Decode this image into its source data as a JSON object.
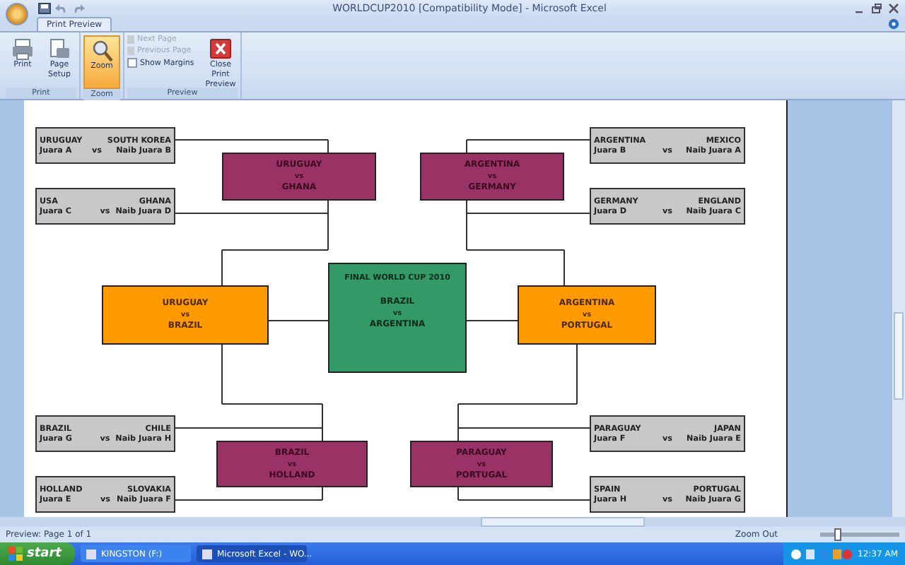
{
  "window": {
    "title": "WORLDCUP2010  [Compatibility Mode] - Microsoft Excel"
  },
  "tabs": [
    {
      "label": "Print Preview",
      "selected": true
    }
  ],
  "ribbon": {
    "groups": [
      {
        "label": "Print",
        "buttons": [
          {
            "kind": "printer",
            "label": "Print",
            "selected": false
          },
          {
            "kind": "setup",
            "label": "Page Setup",
            "selected": false
          }
        ]
      },
      {
        "label": "Zoom",
        "buttons": [
          {
            "kind": "zoom",
            "label": "Zoom",
            "selected": true
          }
        ]
      },
      {
        "label": "Preview",
        "items": [
          {
            "kind": "command",
            "label": "Next Page",
            "disabled": true
          },
          {
            "kind": "command",
            "label": "Previous Page",
            "disabled": true
          },
          {
            "kind": "checkbox",
            "label": "Show Margins",
            "checked": false
          }
        ],
        "buttons": [
          {
            "kind": "close",
            "label": "Close Print Preview",
            "selected": false
          }
        ]
      }
    ]
  },
  "bracket": {
    "round_of_16": [
      {
        "team_a": "URUGUAY",
        "team_b": "SOUTH KOREA",
        "label_a": "Juara A",
        "vs": "vs",
        "label_b": "Naib Juara B"
      },
      {
        "team_a": "USA",
        "team_b": "GHANA",
        "label_a": "Juara C",
        "vs": "vs",
        "label_b": "Naib Juara D"
      },
      {
        "team_a": "BRAZIL",
        "team_b": "CHILE",
        "label_a": "Juara G",
        "vs": "vs",
        "label_b": "Naib Juara H"
      },
      {
        "team_a": "HOLLAND",
        "team_b": "SLOVAKIA",
        "label_a": "Juara E",
        "vs": "vs",
        "label_b": "Naib Juara F"
      },
      {
        "team_a": "ARGENTINA",
        "team_b": "MEXICO",
        "label_a": "Juara B",
        "vs": "vs",
        "label_b": "Naib Juara A"
      },
      {
        "team_a": "GERMANY",
        "team_b": "ENGLAND",
        "label_a": "Juara D",
        "vs": "vs",
        "label_b": "Naib Juara C"
      },
      {
        "team_a": "PARAGUAY",
        "team_b": "JAPAN",
        "label_a": "Juara F",
        "vs": "vs",
        "label_b": "Naib Juara E"
      },
      {
        "team_a": "SPAIN",
        "team_b": "PORTUGAL",
        "label_a": "Juara H",
        "vs": "vs",
        "label_b": "Naib Juara G"
      }
    ],
    "quarterfinals": [
      {
        "team_a": "URUGUAY",
        "vs": "vs",
        "team_b": "GHANA"
      },
      {
        "team_a": "ARGENTINA",
        "vs": "vs",
        "team_b": "GERMANY"
      },
      {
        "team_a": "BRAZIL",
        "vs": "vs",
        "team_b": "HOLLAND"
      },
      {
        "team_a": "PARAGUAY",
        "vs": "vs",
        "team_b": "PORTUGAL"
      }
    ],
    "semifinals": [
      {
        "team_a": "URUGUAY",
        "vs": "vs",
        "team_b": "BRAZIL"
      },
      {
        "team_a": "ARGENTINA",
        "vs": "vs",
        "team_b": "PORTUGAL"
      }
    ],
    "final": {
      "title": "FINAL WORLD CUP 2010",
      "team_a": "BRAZIL",
      "vs": "vs",
      "team_b": "ARGENTINA"
    }
  },
  "status_bar": {
    "text": "Preview: Page 1 of 1",
    "zoom_out": "Zoom Out",
    "zoom_slider": {
      "level": 0.2
    }
  },
  "taskbar": {
    "start": "start",
    "tasks": [
      {
        "label": "KINGSTON (F:)",
        "selected": false
      },
      {
        "label": "Microsoft Excel - WO...",
        "selected": true
      }
    ],
    "clock": "12:37 AM"
  }
}
